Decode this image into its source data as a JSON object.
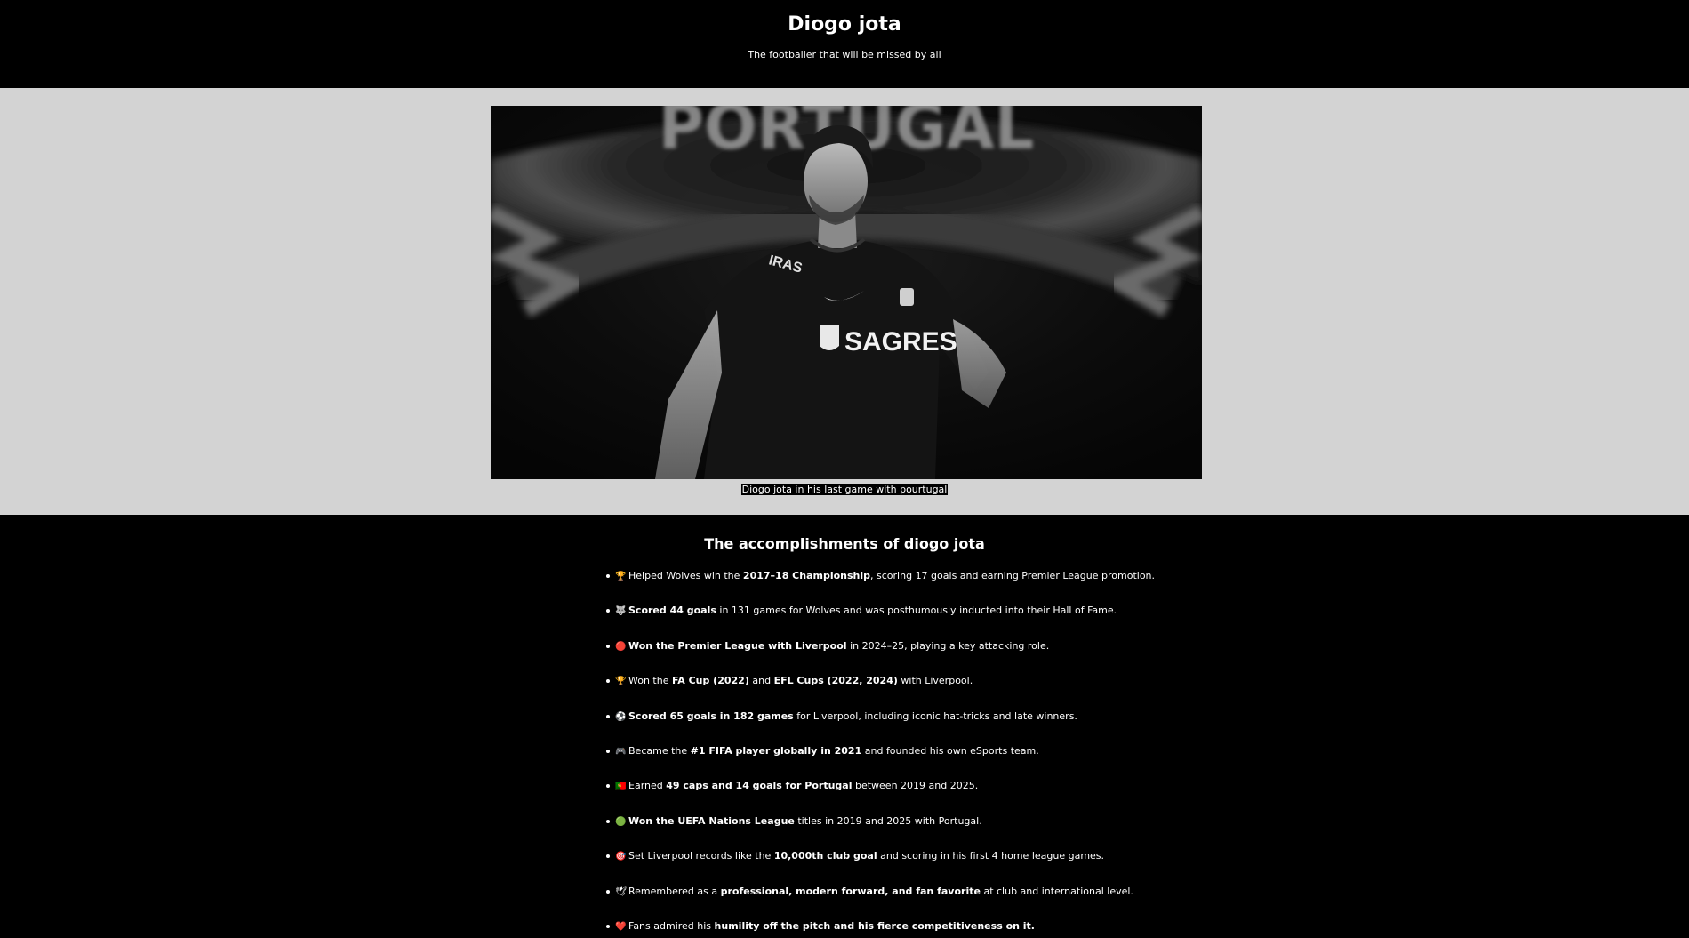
{
  "header": {
    "title": "Diogo jota",
    "subtitle": "The footballer that will be missed by all"
  },
  "figure": {
    "caption": "Diogo jota in his last game with pourtugal",
    "jersey_text": "SAGRES",
    "banner_text": "PORTUGAL",
    "sleeve_text": "IRAS"
  },
  "accomplishments": {
    "heading": "The accomplishments of diogo jota",
    "items": [
      {
        "icon": "🏆",
        "parts": [
          {
            "t": "Helped Wolves win the ",
            "b": false
          },
          {
            "t": "2017–18 Championship",
            "b": true
          },
          {
            "t": ", scoring 17 goals and earning Premier League promotion.",
            "b": false
          }
        ]
      },
      {
        "icon": "🐺",
        "parts": [
          {
            "t": "Scored 44 goals",
            "b": true
          },
          {
            "t": " in 131 games for Wolves and was posthumously inducted into their Hall of Fame.",
            "b": false
          }
        ]
      },
      {
        "icon": "🔴",
        "parts": [
          {
            "t": "Won the Premier League with Liverpool",
            "b": true
          },
          {
            "t": " in 2024–25, playing a key attacking role.",
            "b": false
          }
        ]
      },
      {
        "icon": "🏆",
        "parts": [
          {
            "t": "Won the ",
            "b": false
          },
          {
            "t": "FA Cup (2022)",
            "b": true
          },
          {
            "t": " and ",
            "b": false
          },
          {
            "t": "EFL Cups (2022, 2024)",
            "b": true
          },
          {
            "t": " with Liverpool.",
            "b": false
          }
        ]
      },
      {
        "icon": "⚽",
        "parts": [
          {
            "t": "Scored 65 goals in 182 games",
            "b": true
          },
          {
            "t": " for Liverpool, including iconic hat-tricks and late winners.",
            "b": false
          }
        ]
      },
      {
        "icon": "🎮",
        "parts": [
          {
            "t": "Became the ",
            "b": false
          },
          {
            "t": "#1 FIFA player globally in 2021",
            "b": true
          },
          {
            "t": " and founded his own eSports team.",
            "b": false
          }
        ]
      },
      {
        "icon": "🇵🇹",
        "parts": [
          {
            "t": "Earned ",
            "b": false
          },
          {
            "t": "49 caps and 14 goals for Portugal",
            "b": true
          },
          {
            "t": " between 2019 and 2025.",
            "b": false
          }
        ]
      },
      {
        "icon": "🟢",
        "parts": [
          {
            "t": "Won the UEFA Nations League",
            "b": true
          },
          {
            "t": " titles in 2019 and 2025 with Portugal.",
            "b": false
          }
        ]
      },
      {
        "icon": "🎯",
        "parts": [
          {
            "t": "Set Liverpool records like the ",
            "b": false
          },
          {
            "t": "10,000th club goal",
            "b": true
          },
          {
            "t": " and scoring in his first 4 home league games.",
            "b": false
          }
        ]
      },
      {
        "icon": "🕊",
        "parts": [
          {
            "t": "Remembered as a ",
            "b": false
          },
          {
            "t": "professional, modern forward, and fan favorite",
            "b": true
          },
          {
            "t": " at club and international level.",
            "b": false
          }
        ]
      },
      {
        "icon": "❤️",
        "parts": [
          {
            "t": "Fans admired his ",
            "b": false
          },
          {
            "t": "humility off the pitch and his fierce competitiveness on it.",
            "b": true
          }
        ]
      }
    ]
  }
}
